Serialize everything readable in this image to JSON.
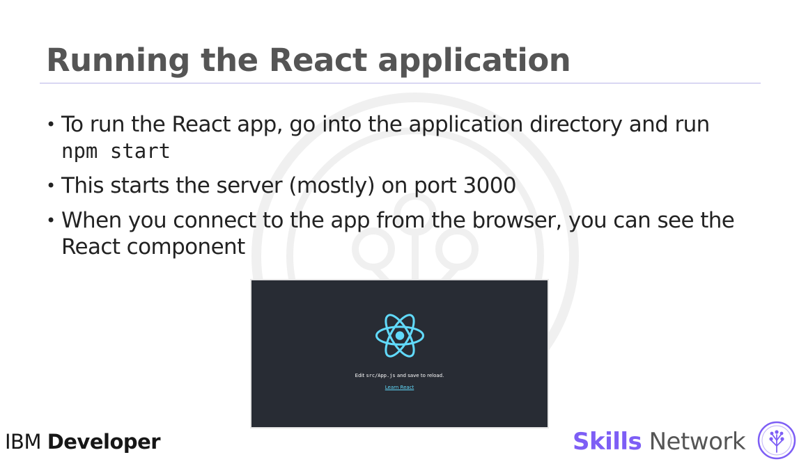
{
  "slide": {
    "title": "Running the React application",
    "bullets": [
      {
        "text": "To run the React app, go into the application directory and run",
        "code": "npm start"
      },
      {
        "text": "This starts the server (mostly) on port 3000"
      },
      {
        "text": "When you connect to the app from the browser, you can see the React component"
      }
    ],
    "bullet_glyph": "•"
  },
  "embedded_screenshot": {
    "edit_prefix": "Edit ",
    "edit_code": "src/App.js",
    "edit_suffix": " and save to reload.",
    "link_label": "Learn React",
    "background": "#282c34",
    "logo_color": "#61dafb",
    "logo_icon": "react-atom-icon"
  },
  "footer": {
    "ibm_prefix": "IBM ",
    "ibm_bold": "Developer",
    "skills_bold": "Skills",
    "skills_rest": " Network",
    "skills_icon": "tree-circle-icon",
    "accent": "#7d5ef5"
  }
}
